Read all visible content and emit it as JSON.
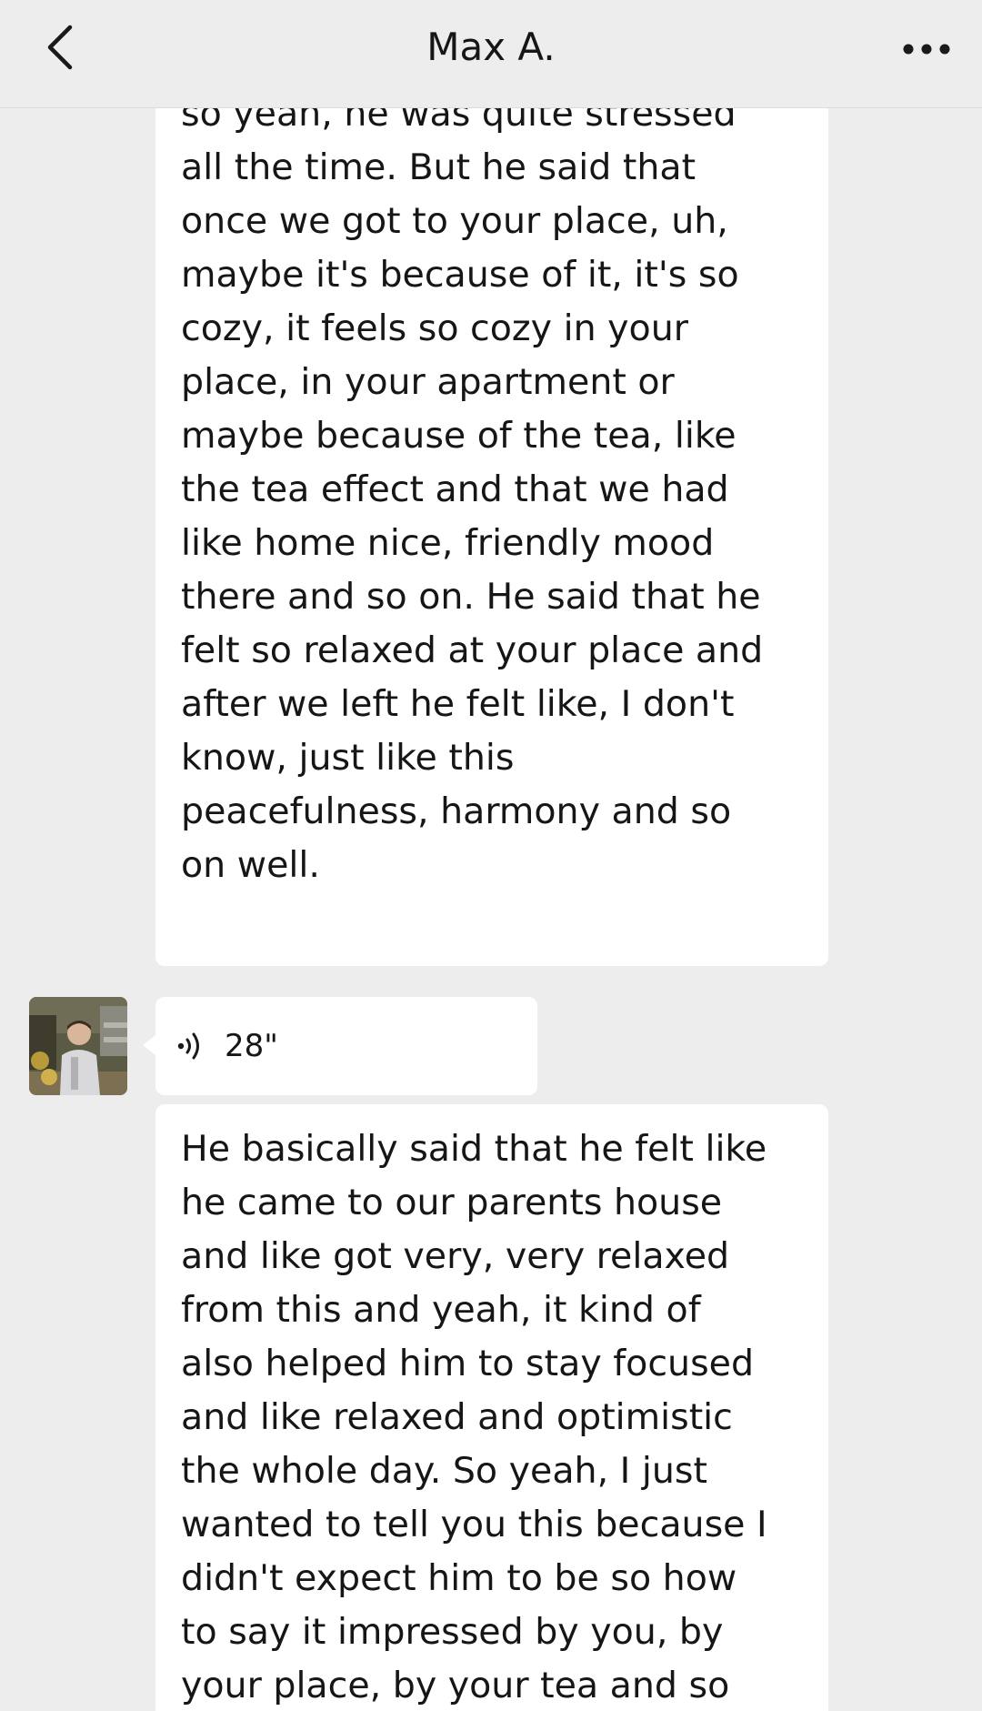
{
  "header": {
    "title": "Max A.",
    "back_icon": "chevron-left-icon",
    "more_icon": "more-horizontal-icon"
  },
  "messages": [
    {
      "type": "text",
      "text": "about many, many things. And\nso yeah, he was quite stressed\nall the time. But he said that\nonce we got to your place, uh,\nmaybe it's because of it, it's so\ncozy, it feels so cozy in your\nplace, in your apartment or\nmaybe because of the tea, like\nthe tea effect and that we had\nlike home nice, friendly mood\nthere and so on. He said that he\nfelt so relaxed at your place and\nafter we left he felt like, I don't\nknow, just like this\npeacefulness, harmony and so\non well."
    },
    {
      "type": "voice",
      "duration": "28\"",
      "icon": "voice-wave-icon"
    },
    {
      "type": "text",
      "text": "He basically said that he felt like\nhe came to our parents house\nand like got very, very relaxed\nfrom this and yeah, it kind of\nalso helped him to stay focused\nand like relaxed and optimistic\nthe whole day. So yeah, I just\nwanted to tell you this because I\ndidn't expect him to be so how\nto say it impressed by you, by\nyour place, by your tea and so"
    }
  ],
  "colors": {
    "background": "#ededed",
    "bubble": "#ffffff",
    "text": "#161616"
  }
}
